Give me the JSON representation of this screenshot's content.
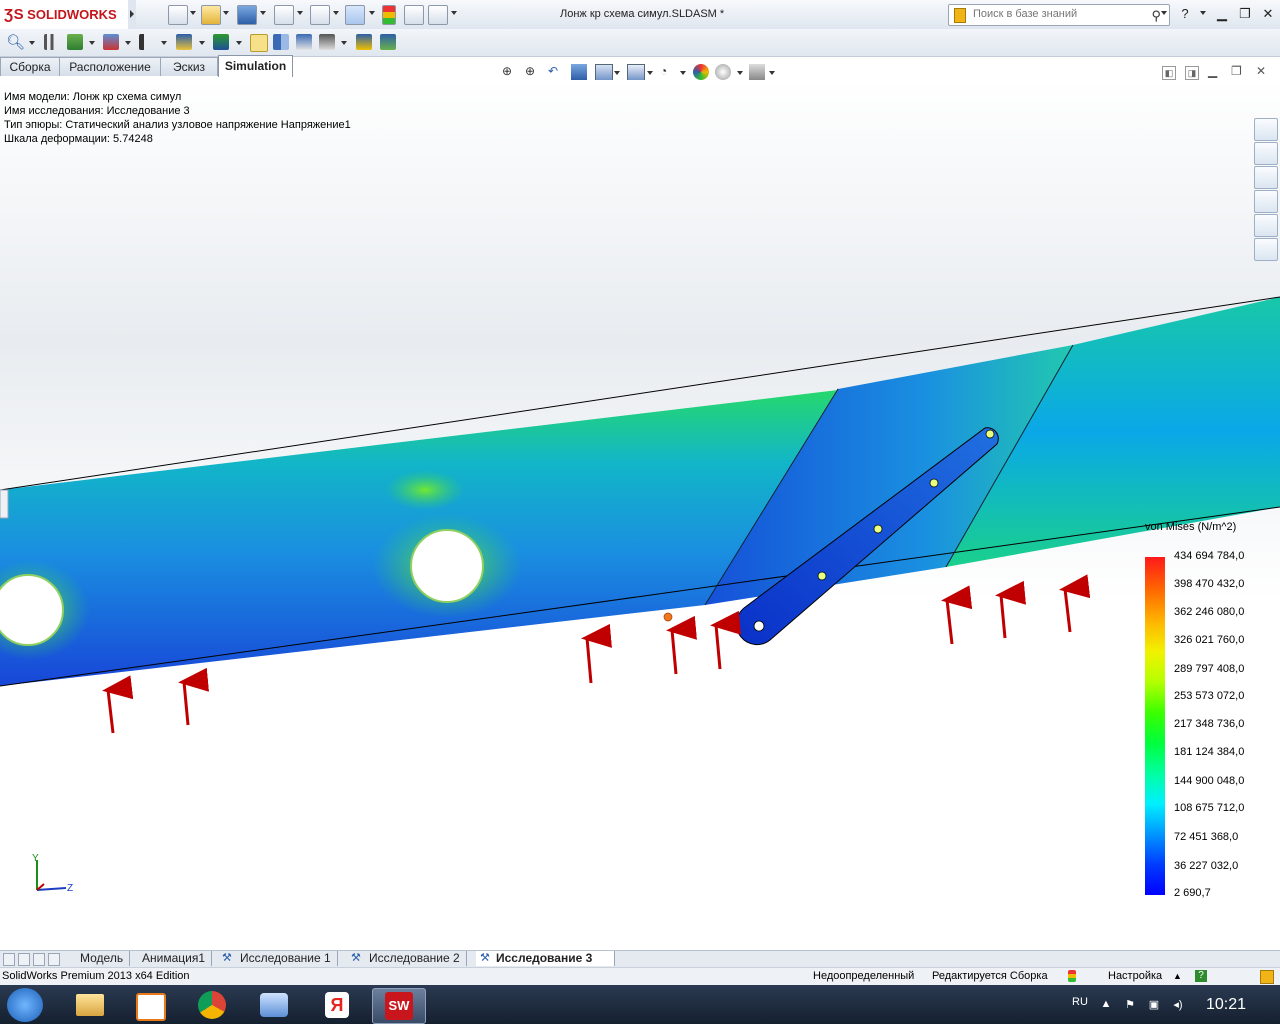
{
  "app": {
    "logo_text": "SOLIDWORKS",
    "document_title": "Лонж кр схема симул.SLDASM *",
    "search_placeholder": "Поиск в базе знаний"
  },
  "command_tabs": [
    {
      "label": "Сборка"
    },
    {
      "label": "Расположение"
    },
    {
      "label": "Эскиз"
    },
    {
      "label": "Simulation",
      "active": true
    }
  ],
  "plot_info": {
    "model_name": "Имя модели: Лонж кр схема симул",
    "study_name": "Имя исследования: Исследование 3",
    "plot_type": "Тип эпюры: Статический анализ узловое напряжение Напряжение1",
    "deformation_scale": "Шкала деформации: 5.74248"
  },
  "legend": {
    "title": "von Mises (N/m^2)",
    "values": [
      "434 694 784,0",
      "398 470 432,0",
      "362 246 080,0",
      "326 021 760,0",
      "289 797 408,0",
      "253 573 072,0",
      "217 348 736,0",
      "181 124 384,0",
      "144 900 048,0",
      "108 675 712,0",
      "72 451 368,0",
      "36 227 032,0",
      "2 690,7"
    ]
  },
  "triad": {
    "y_label": "Y",
    "z_label": "Z"
  },
  "bottom_tabs": [
    {
      "label": "Модель"
    },
    {
      "label": "Анимация1"
    },
    {
      "label": "Исследование 1"
    },
    {
      "label": "Исследование 2"
    },
    {
      "label": "Исследование 3",
      "active": true
    }
  ],
  "status_bar": {
    "edition": "SolidWorks Premium 2013 x64 Edition",
    "definition": "Недоопределенный",
    "editing": "Редактируется Сборка",
    "settings": "Настройка"
  },
  "taskbar": {
    "language": "RU",
    "clock": "10:21"
  },
  "colors": {
    "stress_max": "#ff1a1a",
    "stress_min": "#0000ff",
    "force_arrow": "#c00000"
  }
}
